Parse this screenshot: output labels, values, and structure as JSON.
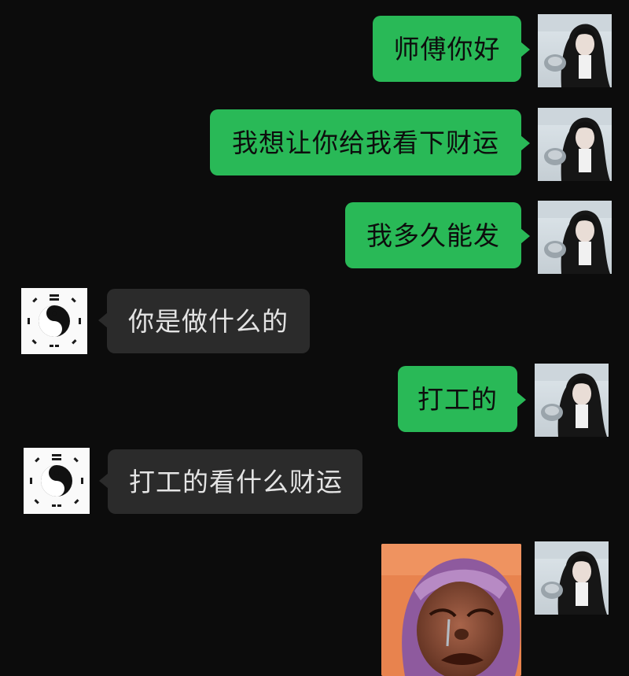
{
  "messages": [
    {
      "sender": "self",
      "text": "师傅你好"
    },
    {
      "sender": "self",
      "text": "我想让你给我看下财运"
    },
    {
      "sender": "self",
      "text": "我多久能发"
    },
    {
      "sender": "master",
      "text": "你是做什么的"
    },
    {
      "sender": "self",
      "text": "打工的"
    },
    {
      "sender": "master",
      "text": "打工的看什么财运"
    },
    {
      "sender": "self",
      "type": "sticker",
      "sticker": "crying-face-sticker"
    }
  ],
  "avatars": {
    "self": "girl-photo-avatar",
    "master": "yin-yang-bagua-avatar"
  },
  "colors": {
    "background": "#0c0c0c",
    "outgoing_bubble": "#29b957",
    "incoming_bubble": "#2b2b2b",
    "incoming_text": "#e4e4e4"
  }
}
